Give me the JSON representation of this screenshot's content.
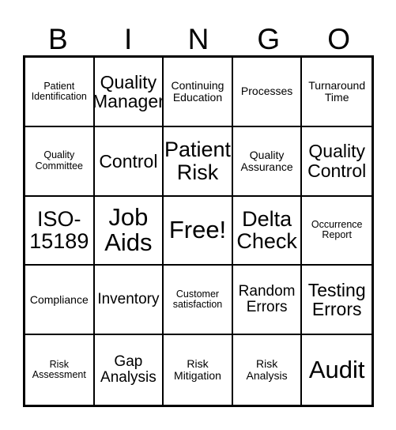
{
  "card": {
    "header_letters": [
      "B",
      "I",
      "N",
      "G",
      "O"
    ],
    "colors": {
      "border": "#000000",
      "cell_background": "#ffffff",
      "text": "#000000",
      "page_background": "#ffffff"
    },
    "grid": {
      "columns": 5,
      "rows": 5,
      "cells": [
        {
          "text": "Patient Identification",
          "size": "xs"
        },
        {
          "text": "Quality Manager",
          "size": "l"
        },
        {
          "text": "Continuing Education",
          "size": "s"
        },
        {
          "text": "Processes",
          "size": "s"
        },
        {
          "text": "Turnaround Time",
          "size": "s"
        },
        {
          "text": "Quality Committee",
          "size": "xs"
        },
        {
          "text": "Control",
          "size": "l"
        },
        {
          "text": "Patient Risk",
          "size": "xl"
        },
        {
          "text": "Quality Assurance",
          "size": "s"
        },
        {
          "text": "Quality Control",
          "size": "l"
        },
        {
          "text": "ISO-15189",
          "size": "xl"
        },
        {
          "text": "Job Aids",
          "size": "xxl"
        },
        {
          "text": "Free!",
          "size": "xxl"
        },
        {
          "text": "Delta Check",
          "size": "xl"
        },
        {
          "text": "Occurrence Report",
          "size": "xs"
        },
        {
          "text": "Compliance",
          "size": "s"
        },
        {
          "text": "Inventory",
          "size": "m"
        },
        {
          "text": "Customer satisfaction",
          "size": "xs"
        },
        {
          "text": "Random Errors",
          "size": "m"
        },
        {
          "text": "Testing Errors",
          "size": "l"
        },
        {
          "text": "Risk Assessment",
          "size": "xs"
        },
        {
          "text": "Gap Analysis",
          "size": "m"
        },
        {
          "text": "Risk Mitigation",
          "size": "s"
        },
        {
          "text": "Risk Analysis",
          "size": "s"
        },
        {
          "text": "Audit",
          "size": "xxl"
        }
      ]
    }
  }
}
